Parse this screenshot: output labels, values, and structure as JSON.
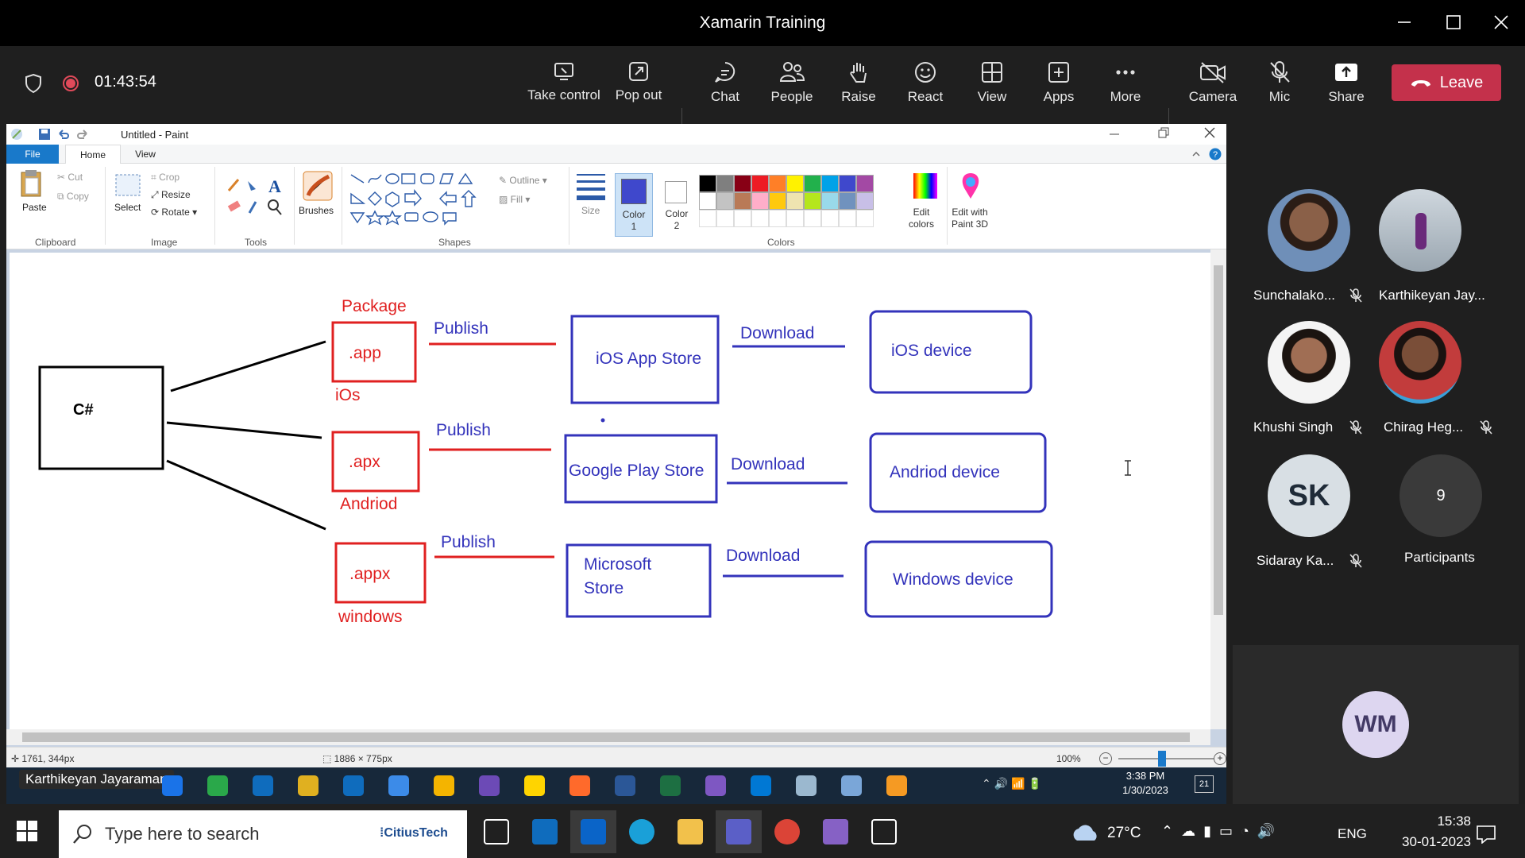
{
  "window": {
    "title": "Xamarin Training"
  },
  "meeting": {
    "timer": "01:43:54",
    "controls": [
      {
        "id": "take-control",
        "label": "Take control"
      },
      {
        "id": "pop-out",
        "label": "Pop out"
      },
      {
        "id": "chat",
        "label": "Chat"
      },
      {
        "id": "people",
        "label": "People"
      },
      {
        "id": "raise",
        "label": "Raise"
      },
      {
        "id": "react",
        "label": "React"
      },
      {
        "id": "view",
        "label": "View"
      },
      {
        "id": "apps",
        "label": "Apps"
      },
      {
        "id": "more",
        "label": "More"
      },
      {
        "id": "camera",
        "label": "Camera"
      },
      {
        "id": "mic",
        "label": "Mic"
      },
      {
        "id": "share",
        "label": "Share"
      }
    ],
    "leave_label": "Leave"
  },
  "paint": {
    "title": "Untitled - Paint",
    "tabs": {
      "file": "File",
      "home": "Home",
      "view": "View"
    },
    "ribbon": {
      "paste": "Paste",
      "cut": "Cut",
      "copy": "Copy",
      "clipboard": "Clipboard",
      "select": "Select",
      "crop": "Crop",
      "resize": "Resize",
      "rotate": "Rotate",
      "image": "Image",
      "tools": "Tools",
      "brushes": "Brushes",
      "shapes": "Shapes",
      "outline": "Outline",
      "fill": "Fill",
      "size": "Size",
      "color1": "Color\n1",
      "color2": "Color\n2",
      "colors": "Colors",
      "edit_colors": "Edit\ncolors",
      "edit_3d": "Edit with\nPaint 3D"
    },
    "palette": [
      "#000000",
      "#7f7f7f",
      "#880015",
      "#ed1c24",
      "#ff7f27",
      "#fff200",
      "#22b14c",
      "#00a2e8",
      "#3f48cc",
      "#a349a4",
      "#ffffff",
      "#c3c3c3",
      "#b97a57",
      "#ffaec9",
      "#ffc90e",
      "#efe4b0",
      "#b5e61d",
      "#99d9ea",
      "#7092be",
      "#c8bfe7"
    ],
    "status": {
      "cursor": "1761, 344px",
      "canvas_size": "1886 × 775px",
      "zoom": "100%"
    },
    "presenter": "Karthikeyan Jayaraman"
  },
  "diagram": {
    "source": "C#",
    "rows": [
      {
        "top": "Package",
        "pkg": ".app",
        "bottom": "iOs",
        "publish": "Publish",
        "store": "iOS App Store",
        "download": "Download",
        "device": "iOS device"
      },
      {
        "top": "",
        "pkg": ".apx",
        "bottom": "Andriod",
        "publish": "Publish",
        "store": "Google Play Store",
        "download": "Download",
        "device": "Andriod device"
      },
      {
        "top": "",
        "pkg": ".appx",
        "bottom": "windows",
        "publish": "Publish",
        "store": "Microsoft\nStore",
        "download": "Download",
        "device": "Windows device"
      }
    ]
  },
  "participants": [
    {
      "name": "Sunchalako...",
      "muted": true
    },
    {
      "name": "Karthikeyan Jay...",
      "muted": false
    },
    {
      "name": "Khushi Singh",
      "muted": true
    },
    {
      "name": "Chirag Heg...",
      "muted": true
    },
    {
      "name": "Sidaray Ka...",
      "initials": "SK",
      "muted": true
    },
    {
      "name": "Participants",
      "count": "9"
    }
  ],
  "self_tile": {
    "initials": "WM"
  },
  "inner_taskbar": {
    "time": "3:38 PM",
    "date": "1/30/2023",
    "badge": "21"
  },
  "taskbar": {
    "search_placeholder": "Type here to search",
    "search_brand": "CitiusTech",
    "weather": "27°C",
    "lang": "ENG",
    "time": "15:38",
    "date": "30-01-2023"
  },
  "colors": {
    "teams_red": "#c4314b",
    "diagram_red": "#e02020",
    "diagram_blue": "#3333bb"
  }
}
